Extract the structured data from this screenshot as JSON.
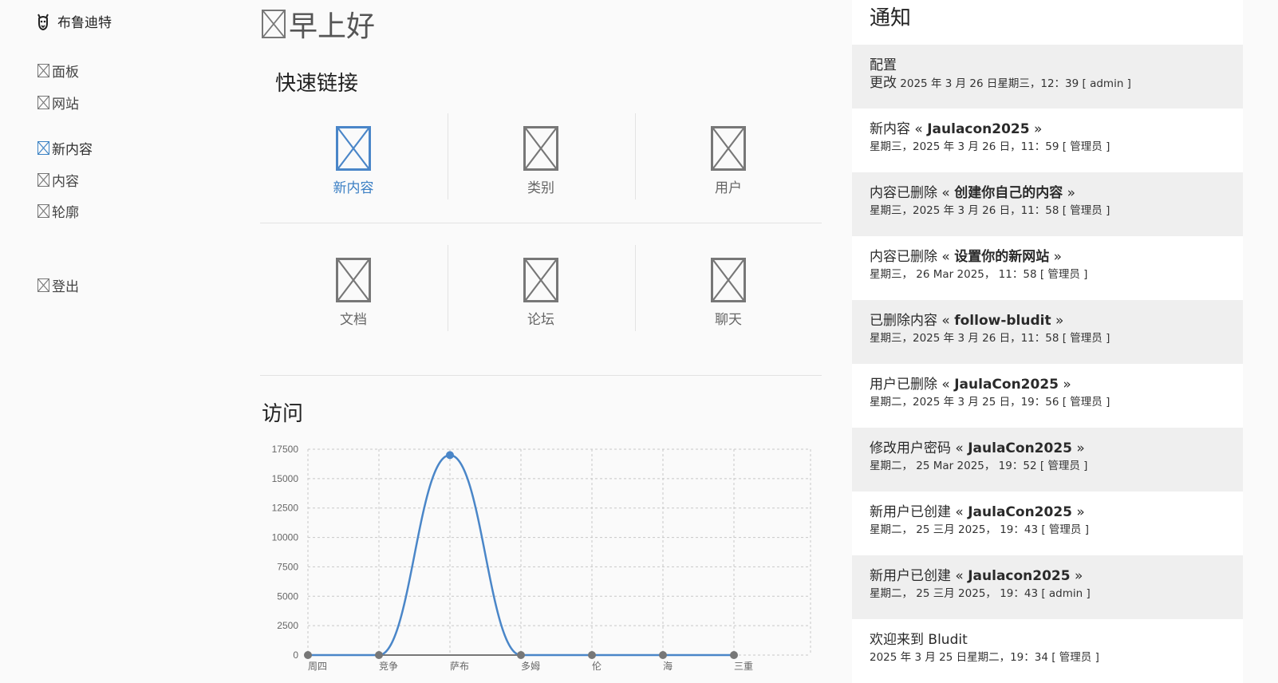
{
  "sidebar": {
    "brand": "布鲁迪特",
    "items": [
      {
        "label": "面板"
      },
      {
        "label": "网站"
      },
      {
        "label": "新内容"
      },
      {
        "label": "内容"
      },
      {
        "label": "轮廓"
      },
      {
        "label": "登出"
      }
    ],
    "active_color": "#3b82c4"
  },
  "main": {
    "greeting": "早上好",
    "quick_links_title": "快速链接",
    "quick_links": [
      {
        "label": "新内容",
        "icon": "new-content-icon"
      },
      {
        "label": "类别",
        "icon": "category-icon"
      },
      {
        "label": "用户",
        "icon": "users-icon"
      },
      {
        "label": "文档",
        "icon": "documentation-icon"
      },
      {
        "label": "论坛",
        "icon": "forum-icon"
      },
      {
        "label": "聊天",
        "icon": "chat-icon"
      }
    ],
    "visits_title": "访问"
  },
  "chart_data": {
    "type": "line",
    "categories": [
      "周四",
      "竞争",
      "萨布",
      "多姆",
      "伦",
      "海",
      "三重"
    ],
    "series": [
      {
        "values": [
          0,
          0,
          17000,
          0,
          0,
          0,
          0
        ]
      }
    ],
    "y_ticks": [
      "0",
      "2500",
      "5000",
      "7500",
      "10000",
      "12500",
      "15000",
      "17500"
    ],
    "ylim": [
      0,
      17500
    ],
    "grid": true,
    "line_color": "#4a86c8",
    "point_color": "#777777"
  },
  "notifications": {
    "title": "通知",
    "items": [
      {
        "title": "配置",
        "bold": "",
        "suffix": "",
        "sub_lead": "更改",
        "sub": " 2025 年 3 月 26 日星期三，12：39 [ admin ]"
      },
      {
        "title": "新内容 « ",
        "bold": "Jaulacon2025",
        "suffix": " »",
        "sub_lead": "",
        "sub": "星期三，2025 年 3 月 26 日，11：59 [ 管理员 ]"
      },
      {
        "title": "内容已删除 « ",
        "bold": "创建你自己的内容",
        "suffix": " »",
        "sub_lead": "",
        "sub": "星期三，2025 年 3 月 26 日，11：58 [ 管理员 ]"
      },
      {
        "title": "内容已删除 « ",
        "bold": "设置你的新网站",
        "suffix": " »",
        "sub_lead": "",
        "sub": "星期三， 26 Mar 2025， 11：58 [ 管理员 ]"
      },
      {
        "title": "已删除内容 « ",
        "bold": "follow-bludit",
        "suffix": " »",
        "sub_lead": "",
        "sub": "星期三，2025 年 3 月 26 日，11：58 [ 管理员 ]"
      },
      {
        "title": "用户已删除 « ",
        "bold": "JaulaCon2025",
        "suffix": " »",
        "sub_lead": "",
        "sub": "星期二，2025 年 3 月 25 日，19：56 [ 管理员 ]"
      },
      {
        "title": "修改用户密码 « ",
        "bold": "JaulaCon2025",
        "suffix": " »",
        "sub_lead": "",
        "sub": "星期二， 25 Mar 2025， 19：52 [ 管理员 ]"
      },
      {
        "title": "新用户已创建 « ",
        "bold": "JaulaCon2025",
        "suffix": " »",
        "sub_lead": "",
        "sub": "星期二， 25 三月 2025， 19：43 [ 管理员 ]"
      },
      {
        "title": "新用户已创建 « ",
        "bold": "Jaulacon2025",
        "suffix": " »",
        "sub_lead": "",
        "sub": "星期二， 25 三月 2025， 19：43 [ admin ]"
      },
      {
        "title": "欢迎来到 Bludit",
        "bold": "",
        "suffix": "",
        "sub_lead": "",
        "sub": "2025 年 3 月 25 日星期二，19：34 [ 管理员 ]"
      }
    ]
  }
}
